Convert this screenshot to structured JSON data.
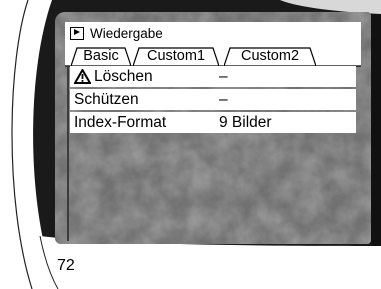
{
  "screen": {
    "title": "Wiedergabe",
    "tabs": [
      {
        "label": "Basic",
        "selected": true
      },
      {
        "label": "Custom1",
        "selected": false
      },
      {
        "label": "Custom2",
        "selected": false
      }
    ],
    "menu": [
      {
        "label": "Löschen",
        "value": "–",
        "icon": "warning-icon"
      },
      {
        "label": "Schützen",
        "value": "–"
      },
      {
        "label": "Index-Format",
        "value": "9 Bilder"
      }
    ]
  },
  "page_number": "72",
  "colors": {
    "camera_body": "#1a1a1a",
    "screen_background": "#6b6b6b",
    "menu_background": "#ffffff",
    "text": "#000000"
  }
}
